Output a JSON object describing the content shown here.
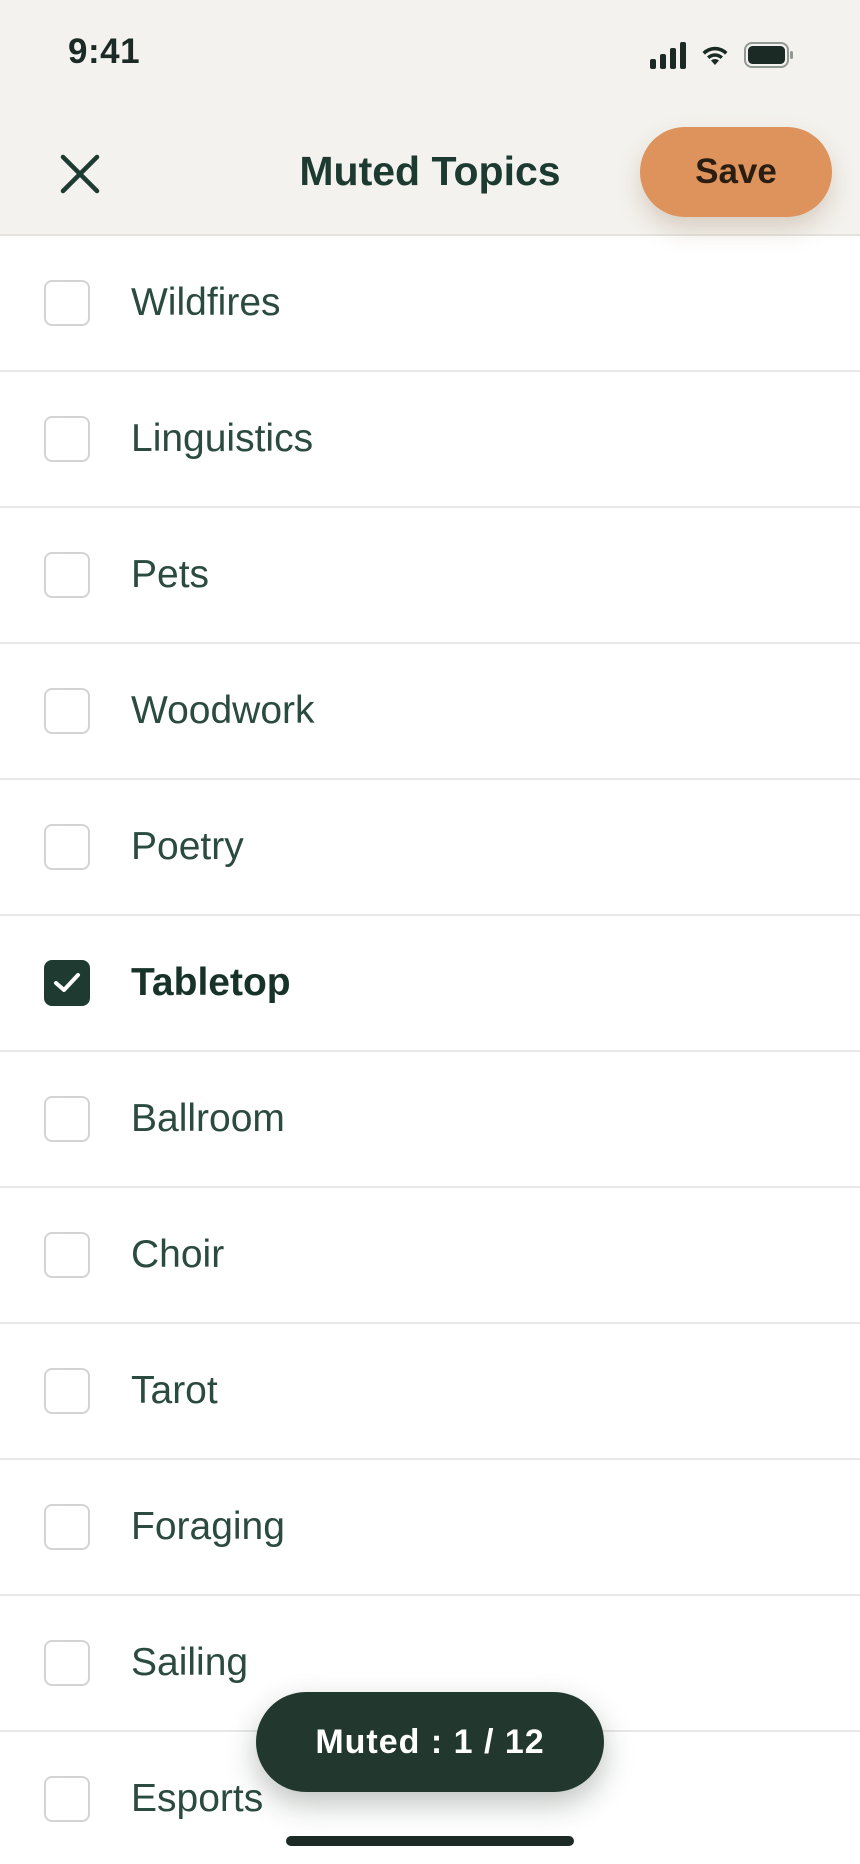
{
  "status_bar": {
    "time": "9:41"
  },
  "header": {
    "title": "Muted Topics",
    "save_label": "Save"
  },
  "topics": [
    {
      "label": "Wildfires",
      "checked": false
    },
    {
      "label": "Linguistics",
      "checked": false
    },
    {
      "label": "Pets",
      "checked": false
    },
    {
      "label": "Woodwork",
      "checked": false
    },
    {
      "label": "Poetry",
      "checked": false
    },
    {
      "label": "Tabletop",
      "checked": true
    },
    {
      "label": "Ballroom",
      "checked": false
    },
    {
      "label": "Choir",
      "checked": false
    },
    {
      "label": "Tarot",
      "checked": false
    },
    {
      "label": "Foraging",
      "checked": false
    },
    {
      "label": "Sailing",
      "checked": false
    },
    {
      "label": "Esports",
      "checked": false
    }
  ],
  "counter": {
    "text": "Muted : 1 / 12"
  },
  "colors": {
    "accent": "#dd935b",
    "primary": "#1e3a31",
    "background": "#f4f2ee"
  }
}
